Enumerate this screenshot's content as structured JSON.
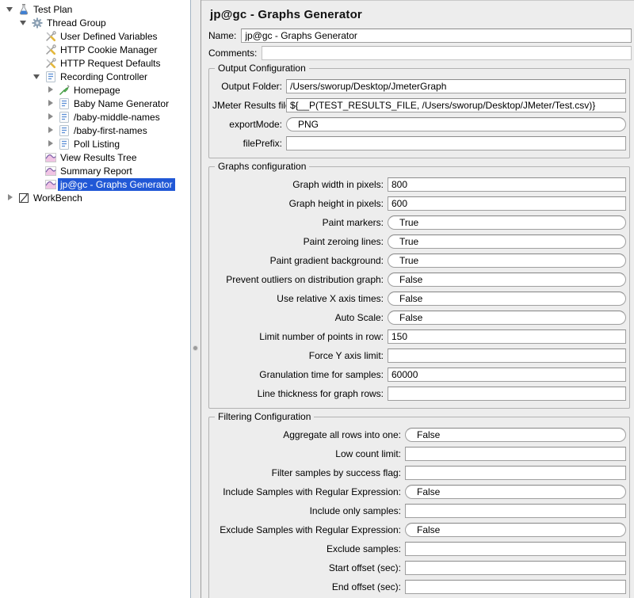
{
  "colors": {
    "selection": "#2158d6",
    "panel_bg": "#ededed",
    "tree_bg": "#ffffff"
  },
  "tree": {
    "items": [
      {
        "label": "Test Plan",
        "level": 0,
        "expander": "expanded",
        "icon": "flask",
        "selected": false
      },
      {
        "label": "Thread Group",
        "level": 1,
        "expander": "expanded",
        "icon": "gear",
        "selected": false
      },
      {
        "label": "User Defined Variables",
        "level": 2,
        "expander": "none",
        "icon": "crossed-tools",
        "selected": false
      },
      {
        "label": "HTTP Cookie Manager",
        "level": 2,
        "expander": "none",
        "icon": "crossed-tools",
        "selected": false
      },
      {
        "label": "HTTP Request Defaults",
        "level": 2,
        "expander": "none",
        "icon": "crossed-tools",
        "selected": false
      },
      {
        "label": "Recording Controller",
        "level": 2,
        "expander": "expanded",
        "icon": "controller",
        "selected": false
      },
      {
        "label": "Homepage",
        "level": 3,
        "expander": "collapsed",
        "icon": "sampler",
        "selected": false
      },
      {
        "label": "Baby Name Generator",
        "level": 3,
        "expander": "collapsed",
        "icon": "controller",
        "selected": false
      },
      {
        "label": "/baby-middle-names",
        "level": 3,
        "expander": "collapsed",
        "icon": "controller",
        "selected": false
      },
      {
        "label": "/baby-first-names",
        "level": 3,
        "expander": "collapsed",
        "icon": "controller",
        "selected": false
      },
      {
        "label": "Poll Listing",
        "level": 3,
        "expander": "collapsed",
        "icon": "controller",
        "selected": false
      },
      {
        "label": "View Results Tree",
        "level": 2,
        "expander": "none",
        "icon": "chart",
        "selected": false
      },
      {
        "label": "Summary Report",
        "level": 2,
        "expander": "none",
        "icon": "chart",
        "selected": false
      },
      {
        "label": "jp@gc - Graphs Generator",
        "level": 2,
        "expander": "none",
        "icon": "chart",
        "selected": true
      },
      {
        "label": "WorkBench",
        "level": 0,
        "expander": "collapsed",
        "icon": "workbench",
        "selected": false
      }
    ]
  },
  "panel": {
    "title": "jp@gc - Graphs Generator",
    "name": {
      "label": "Name:",
      "value": "jp@gc - Graphs Generator"
    },
    "comments": {
      "label": "Comments:",
      "value": ""
    },
    "sections": [
      {
        "title": "Output Configuration",
        "rows": [
          {
            "label": "Output Folder:",
            "value": "/Users/sworup/Desktop/JmeterGraph",
            "type": "text"
          },
          {
            "label": "JMeter Results file:",
            "value": "${__P(TEST_RESULTS_FILE, /Users/sworup/Desktop/JMeter/Test.csv)}",
            "type": "text"
          },
          {
            "label": "exportMode:",
            "value": "PNG",
            "type": "combo"
          },
          {
            "label": "filePrefix:",
            "value": "",
            "type": "text"
          }
        ]
      },
      {
        "title": "Graphs configuration",
        "rows": [
          {
            "label": "Graph width in pixels:",
            "value": "800",
            "type": "text"
          },
          {
            "label": "Graph height in pixels:",
            "value": "600",
            "type": "text"
          },
          {
            "label": "Paint markers:",
            "value": "True",
            "type": "combo"
          },
          {
            "label": "Paint zeroing lines:",
            "value": "True",
            "type": "combo"
          },
          {
            "label": "Paint gradient background:",
            "value": "True",
            "type": "combo"
          },
          {
            "label": "Prevent outliers on distribution graph:",
            "value": "False",
            "type": "combo"
          },
          {
            "label": "Use relative X axis times:",
            "value": "False",
            "type": "combo"
          },
          {
            "label": "Auto Scale:",
            "value": "False",
            "type": "combo"
          },
          {
            "label": "Limit number of points in row:",
            "value": "150",
            "type": "text"
          },
          {
            "label": "Force Y axis limit:",
            "value": "",
            "type": "text"
          },
          {
            "label": "Granulation time for samples:",
            "value": "60000",
            "type": "text"
          },
          {
            "label": "Line thickness for graph rows:",
            "value": "",
            "type": "text"
          }
        ]
      },
      {
        "title": "Filtering Configuration",
        "rows": [
          {
            "label": "Aggregate all rows into one:",
            "value": "False",
            "type": "combo"
          },
          {
            "label": "Low count limit:",
            "value": "",
            "type": "text"
          },
          {
            "label": "Filter samples by success flag:",
            "value": "",
            "type": "text"
          },
          {
            "label": "Include Samples with Regular Expression:",
            "value": "False",
            "type": "combo"
          },
          {
            "label": "Include only samples:",
            "value": "",
            "type": "text"
          },
          {
            "label": "Exclude Samples with Regular Expression:",
            "value": "False",
            "type": "combo"
          },
          {
            "label": "Exclude samples:",
            "value": "",
            "type": "text"
          },
          {
            "label": "Start offset (sec):",
            "value": "",
            "type": "text"
          },
          {
            "label": "End offset (sec):",
            "value": "",
            "type": "text"
          }
        ]
      }
    ]
  }
}
